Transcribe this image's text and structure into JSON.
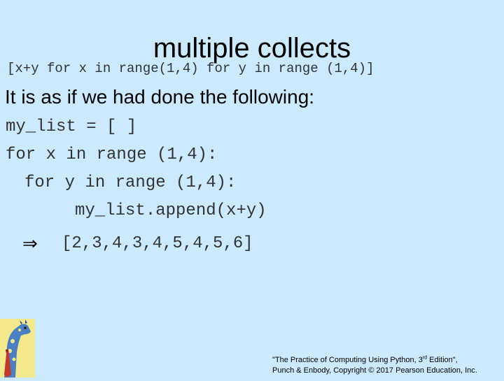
{
  "slide": {
    "title": "multiple collects",
    "comprehension": "[x+y for x in range(1,4) for y in range (1,4)]",
    "intro": "It is as if we had done the following:",
    "code_lines": [
      "my_list = [ ]",
      "for x in range (1,4):",
      "for y in range (1,4):",
      "my_list.append(x+y)"
    ],
    "arrow_icon": "implies-arrow-icon",
    "result": "[2,3,4,3,4,5,4,5,6]"
  },
  "footer": {
    "line1_before": "\"The Practice of Computing Using Python, 3",
    "line1_sup": "rd",
    "line1_after": " Edition\",",
    "line2": "Punch & Enbody, Copyright © 2017 Pearson Education, Inc."
  },
  "colors": {
    "background": "#cbeafd",
    "code_text": "#333333",
    "mascot_background": "#f3e88b",
    "mascot_body": "#4a7fc1",
    "mascot_tie": "#c0392b"
  }
}
